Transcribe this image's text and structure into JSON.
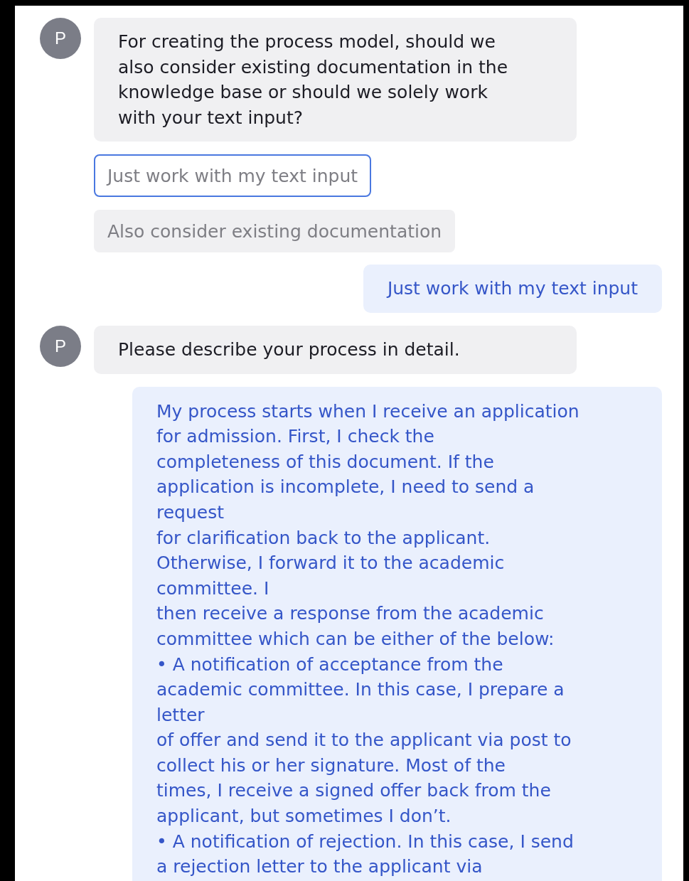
{
  "messages": [
    {
      "kind": "bot",
      "avatar": "P",
      "text": "For creating the process model, should we\nalso consider existing documentation in the\nknowledge base or should we solely work\nwith your text input?"
    },
    {
      "kind": "options",
      "options": [
        {
          "label": "Just work with my text input",
          "selected": true
        },
        {
          "label": "Also consider existing documentation",
          "selected": false
        }
      ]
    },
    {
      "kind": "user",
      "text": "Just work with my text input"
    },
    {
      "kind": "bot",
      "avatar": "P",
      "text": "Please describe your process in detail."
    },
    {
      "kind": "user",
      "text": "My process starts when I receive an application\nfor admission. First, I check the\ncompleteness of this document. If the\napplication is incomplete, I need to send a\nrequest\nfor clarification back to the applicant.\nOtherwise, I forward it to the academic\ncommittee. I\nthen receive a response from the academic\ncommittee which can be either of the below:\n• A notification of acceptance from the\nacademic committee. In this case, I prepare a\nletter\nof offer and send it to the applicant via post to\ncollect his or her signature. Most of the\ntimes, I receive a signed offer back from the\napplicant, but sometimes I don’t.\n• A notification of rejection. In this case, I send\na rejection letter to the applicant via"
    }
  ]
}
